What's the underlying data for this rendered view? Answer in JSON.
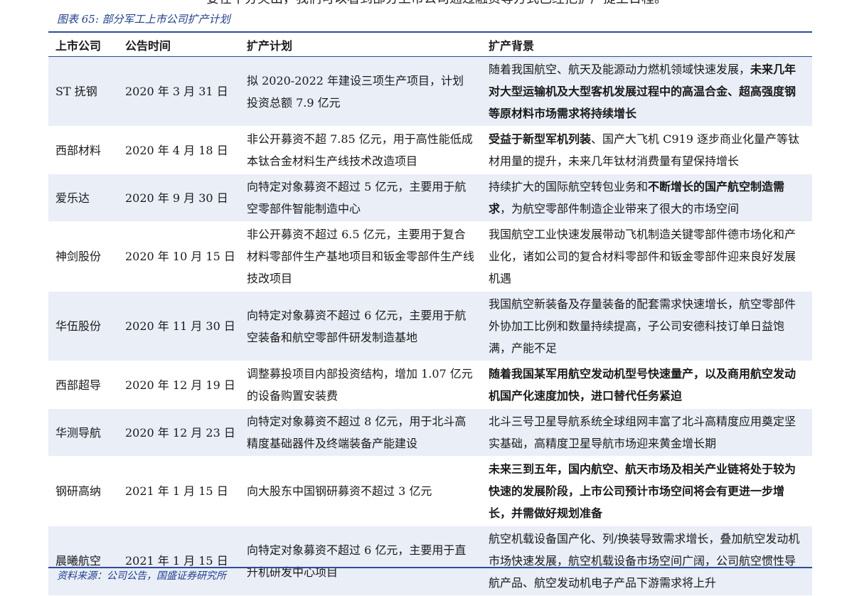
{
  "top_text": "要在十分突出，我们可以看到部分上市公司通过融资等方式已经把扩产提上日程。",
  "caption": "图表 65:  部分军工上市公司扩产计划",
  "headers": [
    "上市公司",
    "公告时间",
    "扩产计划",
    "扩产背景"
  ],
  "rows": [
    {
      "company": "ST 抚钢",
      "date": "2020 年 3 月 31 日",
      "plan": "拟 2020-2022 年建设三项生产项目，计划投资总额 7.9 亿元",
      "bg_normal": "随着我国航空、航天及能源动力燃机领域快速发展，",
      "bg_bold": "未来几年对大型运输机及大型客机发展过程中的高温合金、超高强度钢等原材料市场需求将持续增长",
      "bg_tail": ""
    },
    {
      "company": "西部材料",
      "date": "2020 年 4 月 18 日",
      "plan": "非公开募资不超 7.85 亿元，用于高性能低成本钛合金材料生产线技术改造项目",
      "bg_normal": "",
      "bg_bold": "受益于新型军机列装",
      "bg_tail": "、国产大飞机 C919 逐步商业化量产等钛材用量的提升，未来几年钛材消费量有望保持增长"
    },
    {
      "company": "爱乐达",
      "date": "2020 年 9 月 30 日",
      "plan": "向特定对象募资不超过 5 亿元，主要用于航空零部件智能制造中心",
      "bg_normal": "持续扩大的国际航空转包业务和",
      "bg_bold": "不断增长的国产航空制造需求",
      "bg_tail": "，为航空零部件制造企业带来了很大的市场空间"
    },
    {
      "company": "神剑股份",
      "date": "2020 年 10 月 15 日",
      "plan": "非公开募资不超过 6.5 亿元，主要用于复合材料零部件生产基地项目和钣金零部件生产线技改项目",
      "bg_normal": "我国航空工业快速发展带动飞机制造关键零部件德市场化和产业化，诸如公司的复合材料零部件和钣金零部件迎来良好发展机遇",
      "bg_bold": "",
      "bg_tail": ""
    },
    {
      "company": "华伍股份",
      "date": "2020 年 11 月 30 日",
      "plan": "向特定对象募资不超过 6 亿元，主要用于航空装备和航空零部件研发制造基地",
      "bg_normal": "我国航空新装备及存量装备的配套需求快速增长，航空零部件外协加工比例和数量持续提高，子公司安德科技订单日益饱满，产能不足",
      "bg_bold": "",
      "bg_tail": ""
    },
    {
      "company": "西部超导",
      "date": "2020 年 12 月 19 日",
      "plan": "调整募投项目内部投资结构，增加 1.07 亿元的设备购置安装费",
      "bg_normal": "",
      "bg_bold": "随着我国某军用航空发动机型号快速量产，以及商用航空发动机国产化速度加快，进口替代任务紧迫",
      "bg_tail": ""
    },
    {
      "company": "华测导航",
      "date": "2020 年 12 月 23 日",
      "plan": "向特定对象募资不超过 8 亿元，用于北斗高精度基础器件及终端装备产能建设",
      "bg_normal": "北斗三号卫星导航系统全球组网丰富了北斗高精度应用奠定坚实基础，高精度卫星导航市场迎来黄金增长期",
      "bg_bold": "",
      "bg_tail": ""
    },
    {
      "company": "钢研高纳",
      "date": "2021 年 1 月 15 日",
      "plan": "向大股东中国钢研募资不超过 3 亿元",
      "bg_normal": "",
      "bg_bold": "未来三到五年，国内航空、航天市场及相关产业链将处于较为快速的发展阶段，上市公司预计市场空间将会有更进一步增长，并需做好规划准备",
      "bg_tail": ""
    },
    {
      "company": "晨曦航空",
      "date": "2021 年 1 月 15 日",
      "plan": "向特定对象募资不超过 6 亿元，主要用于直升机研发中心项目",
      "bg_normal": "航空机载设备国产化、列/换装导致需求增长，叠加航空发动机市场快速发展，航空机载设备市场空间广阔，公司航空惯性导航产品、航空发动机电子产品下游需求将上升",
      "bg_bold": "",
      "bg_tail": ""
    }
  ],
  "source": "资料来源：公司公告，国盛证券研究所"
}
